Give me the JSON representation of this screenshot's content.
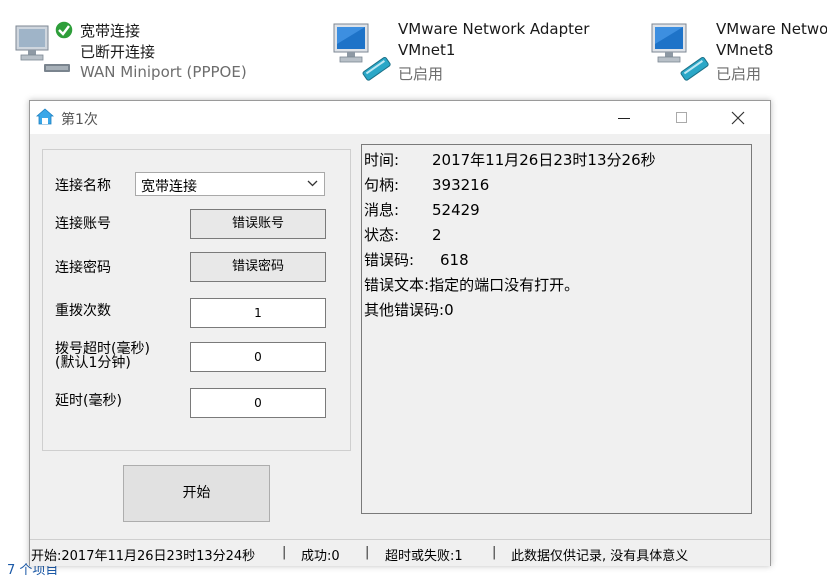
{
  "network": {
    "items": [
      {
        "name": "宽带连接",
        "status": "已断开连接",
        "device": "WAN Miniport (PPPOE)"
      },
      {
        "name": "VMware Network Adapter",
        "name2": "VMnet1",
        "status": "已启用"
      },
      {
        "name": "VMware Network",
        "name2": "VMnet8",
        "status": "已启用"
      }
    ],
    "items_count": "7 个项目"
  },
  "dialog": {
    "title": "第1次",
    "form": {
      "connection_name_label": "连接名称",
      "connection_name_value": "宽带连接",
      "account_label": "连接账号",
      "account_button": "错误账号",
      "password_label": "连接密码",
      "password_button": "错误密码",
      "redial_label": "重拨次数",
      "redial_value": "1",
      "timeout_label_1": "拨号超时(毫秒)",
      "timeout_label_2": "(默认1分钟)",
      "timeout_value": "0",
      "delay_label": "延时(毫秒)",
      "delay_value": "0",
      "start_button": "开始"
    },
    "log": [
      {
        "key": "时间:",
        "value": "2017年11月26日23时13分26秒"
      },
      {
        "key": "句柄:",
        "value": "393216"
      },
      {
        "key": "消息:",
        "value": "52429"
      },
      {
        "key": "状态:",
        "value": "2"
      },
      {
        "key": "错误码:",
        "value": "618"
      },
      {
        "key": "错误文本:",
        "value": "指定的端口没有打开。"
      },
      {
        "key": "其他错误码:",
        "value": "0"
      }
    ],
    "statusbar": {
      "start": "开始:2017年11月26日23时13分24秒",
      "success": "成功:0",
      "fail": "超时或失败:1",
      "note": "此数据仅供记录, 没有具体意义",
      "separator": "|"
    }
  },
  "colors": {
    "link_blue": "#1c5aa8",
    "check_green": "#2e9e3a",
    "monitor_blue": "#1e73c8"
  }
}
